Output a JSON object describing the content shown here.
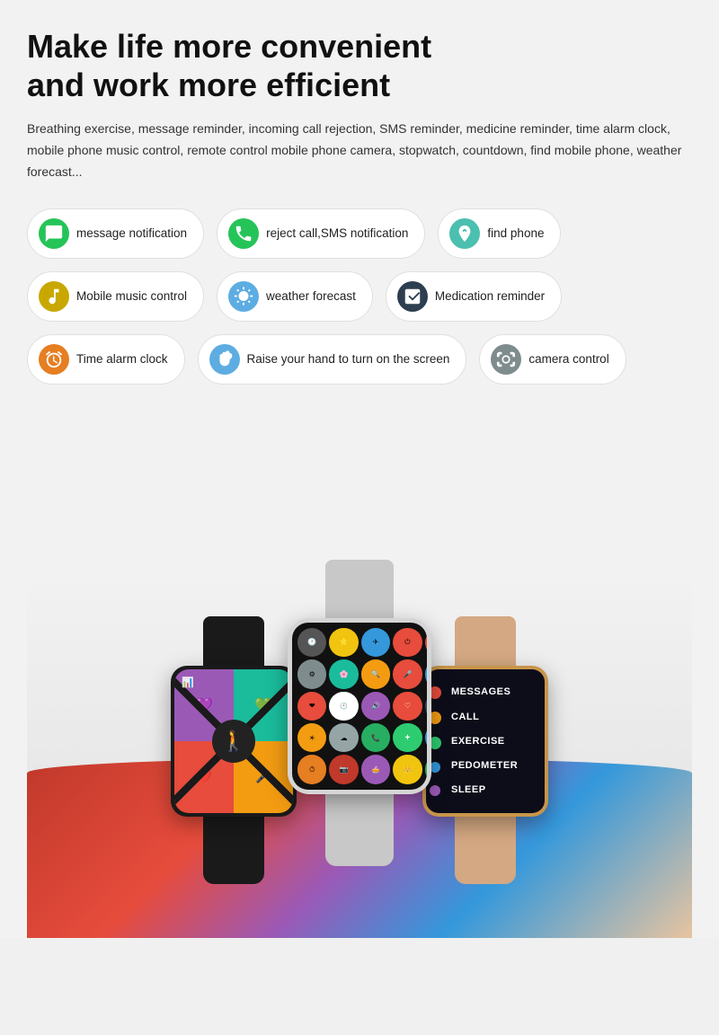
{
  "header": {
    "title_line1": "Make life more convenient",
    "title_line2": "and work more efficient",
    "description": "Breathing exercise, message reminder, incoming call rejection, SMS reminder, medicine reminder, time alarm clock, mobile phone music control, remote control mobile phone camera, stopwatch, countdown, find mobile phone, weather forecast..."
  },
  "features": {
    "row1": [
      {
        "label": "message notification",
        "icon": "💬",
        "bg": "green"
      },
      {
        "label": "reject call,SMS notification",
        "icon": "📞",
        "bg": "green2"
      },
      {
        "label": "find phone",
        "icon": "🎯",
        "bg": "teal"
      }
    ],
    "row2": [
      {
        "label": "Mobile music control",
        "icon": "🎵",
        "bg": "purple"
      },
      {
        "label": "weather forecast",
        "icon": "🌤",
        "bg": "blue"
      },
      {
        "label": "Medication reminder",
        "icon": "💊",
        "bg": "dark"
      }
    ],
    "row3": [
      {
        "label": "Time alarm clock",
        "icon": "⏰",
        "bg": "orange"
      },
      {
        "label": "Raise your hand to turn on the screen",
        "icon": "✋",
        "bg": "lightblue"
      },
      {
        "label": "camera control",
        "icon": "📷",
        "bg": "gray"
      }
    ]
  },
  "watches": {
    "left": {
      "band_color": "#1a1a1a",
      "menu": []
    },
    "middle": {
      "band_color": "#c8c8c8"
    },
    "right": {
      "band_color": "#d4a882",
      "menu_items": [
        "MESSAGES",
        "CALL",
        "EXERCISE",
        "PEDOMETER",
        "SLEEP"
      ]
    }
  }
}
